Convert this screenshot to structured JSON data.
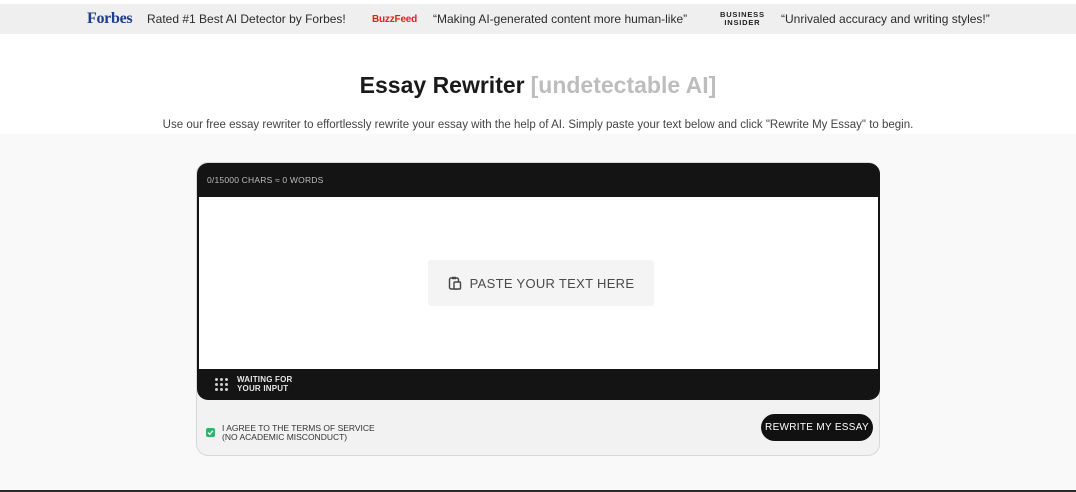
{
  "press": [
    {
      "logo": "Forbes",
      "quote": "Rated #1 Best AI Detector by Forbes!"
    },
    {
      "logo": "BuzzFeed",
      "quote": "“Making AI-generated content more human-like”"
    },
    {
      "logo_line1": "BUSINESS",
      "logo_line2": "INSIDER",
      "quote": "“Unrivaled accuracy and writing styles!”"
    }
  ],
  "header": {
    "title": "Essay Rewriter",
    "title_accent": "[undetectable AI]",
    "subtitle": "Use our free essay rewriter to effortlessly rewrite your essay with the help of AI. Simply paste your text below and click \"Rewrite My Essay\" to begin."
  },
  "editor": {
    "counter": "0/15000 CHARS ≈ 0 WORDS",
    "paste_label": "PASTE YOUR TEXT HERE",
    "paste_icon": "clipboard-icon",
    "status_line1": "WAITING FOR",
    "status_line2": "YOUR INPUT"
  },
  "footer": {
    "agree_line1": "I AGREE TO THE TERMS OF SERVICE",
    "agree_line2": "(NO ACADEMIC MISCONDUCT)",
    "agree_checked": true,
    "rewrite_label": "REWRITE MY ESSAY"
  },
  "colors": {
    "forbes": "#1d3e8a",
    "buzzfeed": "#e32119",
    "checkbox": "#2fb36b",
    "dark": "#141414"
  }
}
